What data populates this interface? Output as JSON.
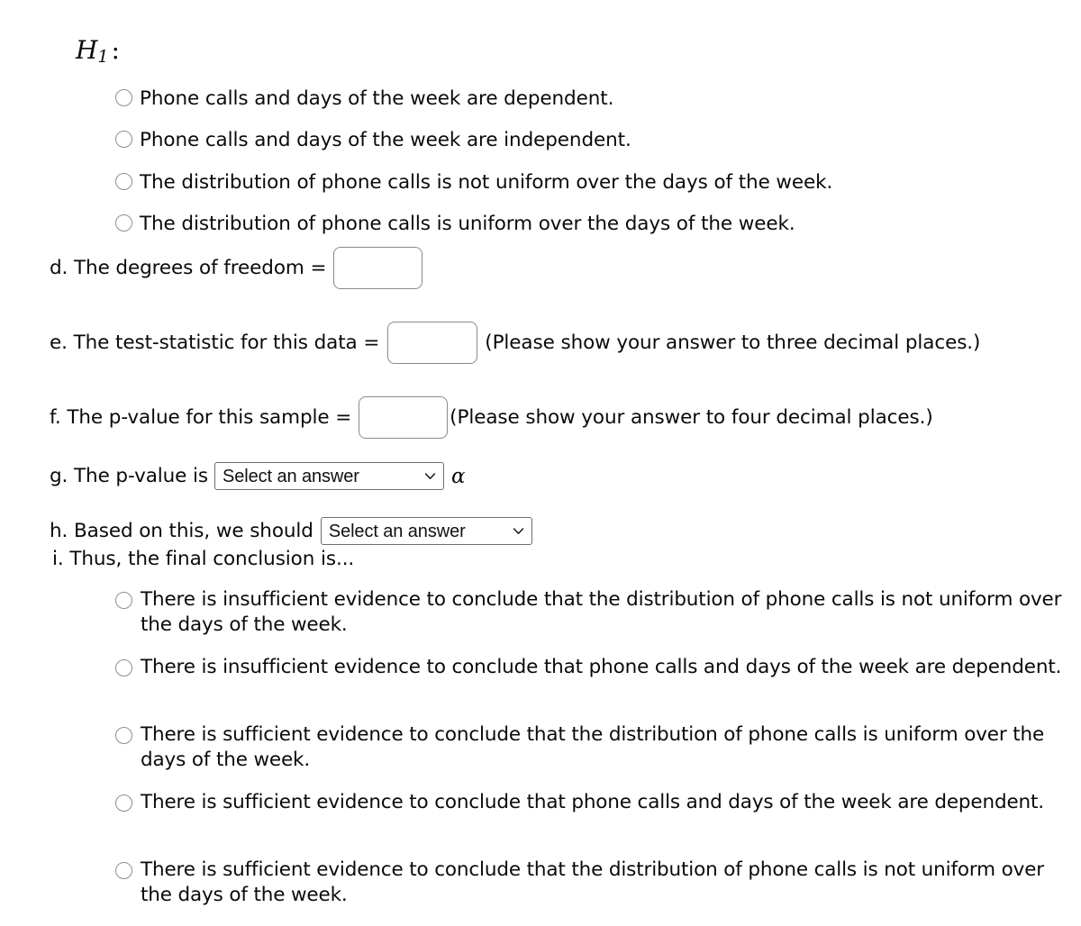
{
  "hypothesis": {
    "label_main": "H",
    "label_sub": "1",
    "label_colon": ":",
    "options": [
      "Phone calls and days of the week are dependent.",
      "Phone calls and days of the week are independent.",
      "The distribution of phone calls is not uniform over the days of the week.",
      "The distribution of phone calls is uniform over the days of the week."
    ]
  },
  "items": {
    "d": {
      "text": "d. The degrees of freedom =",
      "input_value": "",
      "input_placeholder": ""
    },
    "e": {
      "text": "e. The test-statistic for this data =",
      "input_value": "",
      "input_placeholder": "",
      "note": "(Please show your answer to three decimal places.)"
    },
    "f": {
      "text": "f. The p-value for this sample =",
      "input_value": "",
      "input_placeholder": "",
      "note": "(Please show your answer to four decimal places.)"
    },
    "g": {
      "text": "g. The p-value is",
      "select_value": "Select an answer",
      "alpha": "α"
    },
    "h": {
      "text": "h. Based on this, we should",
      "select_value": "Select an answer"
    },
    "i": {
      "text": "i. Thus, the final conclusion is..."
    }
  },
  "conclusion_options": [
    "There is insufficient evidence to conclude that the distribution of phone calls is not uniform over the days of the week.",
    "There is insufficient evidence to conclude that phone calls and days of the week are dependent.",
    "There is sufficient evidence to conclude that the distribution of phone calls is uniform over the days of the week.",
    "There is sufficient evidence to conclude that phone calls and days of the week are dependent.",
    "There is sufficient evidence to conclude that the distribution of phone calls is not uniform over the days of the week."
  ],
  "icons": {
    "radio": "radio-unselected-icon",
    "chevron": "chevron-down-icon"
  },
  "colors": {
    "background": "#ffffff",
    "text": "#0a0a0a",
    "input_border": "#8a8a8a",
    "select_border": "#6f6f6f",
    "radio_border": "#8e8e8e"
  }
}
